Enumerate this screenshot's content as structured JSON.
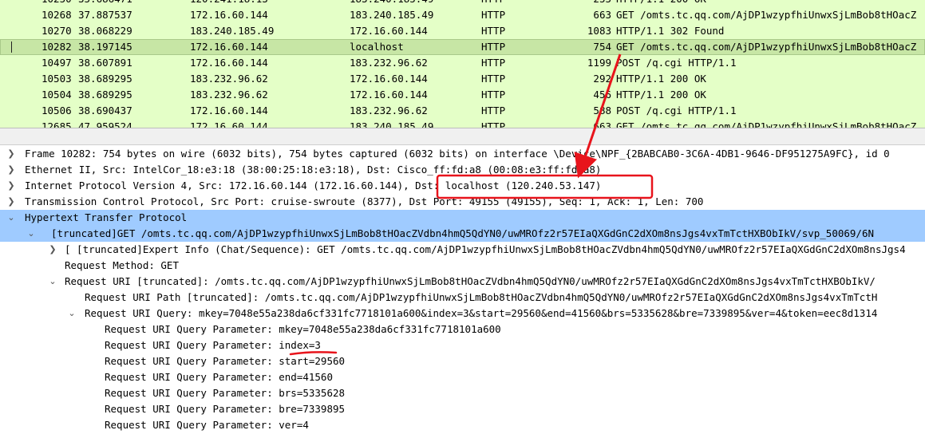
{
  "packet_list": {
    "rows": [
      {
        "no": "10250",
        "time": "35.686471",
        "src": "120.241.18.13",
        "dst": "183.240.185.49",
        "proto": "HTTP",
        "len": "255",
        "info": "HTTP/1.1 200 OK"
      },
      {
        "no": "10268",
        "time": "37.887537",
        "src": "172.16.60.144",
        "dst": "183.240.185.49",
        "proto": "HTTP",
        "len": "663",
        "info": "GET /omts.tc.qq.com/AjDP1wzypfhiUnwxSjLmBob8tHOacZ"
      },
      {
        "no": "10270",
        "time": "38.068229",
        "src": "183.240.185.49",
        "dst": "172.16.60.144",
        "proto": "HTTP",
        "len": "1083",
        "info": "HTTP/1.1 302 Found"
      },
      {
        "no": "10282",
        "time": "38.197145",
        "src": "172.16.60.144",
        "dst": "localhost",
        "proto": "HTTP",
        "len": "754",
        "info": "GET /omts.tc.qq.com/AjDP1wzypfhiUnwxSjLmBob8tHOacZ"
      },
      {
        "no": "10497",
        "time": "38.607891",
        "src": "172.16.60.144",
        "dst": "183.232.96.62",
        "proto": "HTTP",
        "len": "1199",
        "info": "POST /q.cgi HTTP/1.1"
      },
      {
        "no": "10503",
        "time": "38.689295",
        "src": "183.232.96.62",
        "dst": "172.16.60.144",
        "proto": "HTTP",
        "len": "292",
        "info": "HTTP/1.1 200 OK"
      },
      {
        "no": "10504",
        "time": "38.689295",
        "src": "183.232.96.62",
        "dst": "172.16.60.144",
        "proto": "HTTP",
        "len": "456",
        "info": "HTTP/1.1 200 OK"
      },
      {
        "no": "10506",
        "time": "38.690437",
        "src": "172.16.60.144",
        "dst": "183.232.96.62",
        "proto": "HTTP",
        "len": "588",
        "info": "POST /q.cgi HTTP/1.1"
      },
      {
        "no": "12685",
        "time": "47.959524",
        "src": "172.16.60.144",
        "dst": "183.240.185.49",
        "proto": "HTTP",
        "len": "663",
        "info": "GET /omts.tc.qq.com/AjDP1wzypfhiUnwxSjLmBob8tHOacZ"
      }
    ]
  },
  "details": {
    "frame": "Frame 10282: 754 bytes on wire (6032 bits), 754 bytes captured (6032 bits) on interface \\Device\\NPF_{2BABCAB0-3C6A-4DB1-9646-DF951275A9FC}, id 0",
    "ethernet": "Ethernet II, Src: IntelCor_18:e3:18 (38:00:25:18:e3:18), Dst: Cisco_ff:fd:a8 (00:08:e3:ff:fd:a8)",
    "ip": "Internet Protocol Version 4, Src: 172.16.60.144 (172.16.60.144), Dst: localhost (120.240.53.147)",
    "tcp": "Transmission Control Protocol, Src Port: cruise-swroute (8377), Dst Port: 49155 (49155), Seq: 1, Ack: 1, Len: 700",
    "http": "Hypertext Transfer Protocol",
    "http_get": "[truncated]GET /omts.tc.qq.com/AjDP1wzypfhiUnwxSjLmBob8tHOacZVdbn4hmQ5QdYN0/uwMROfz2r57EIaQXGdGnC2dXOm8nsJgs4vxTmTctHXBObIkV/svp_50069/6N",
    "expert": "[ [truncated]Expert Info (Chat/Sequence): GET /omts.tc.qq.com/AjDP1wzypfhiUnwxSjLmBob8tHOacZVdbn4hmQ5QdYN0/uwMROfz2r57EIaQXGdGnC2dXOm8nsJgs4",
    "method": "Request Method: GET",
    "uri": "Request URI [truncated]: /omts.tc.qq.com/AjDP1wzypfhiUnwxSjLmBob8tHOacZVdbn4hmQ5QdYN0/uwMROfz2r57EIaQXGdGnC2dXOm8nsJgs4vxTmTctHXBObIkV/",
    "uri_path": "Request URI Path [truncated]: /omts.tc.qq.com/AjDP1wzypfhiUnwxSjLmBob8tHOacZVdbn4hmQ5QdYN0/uwMROfz2r57EIaQXGdGnC2dXOm8nsJgs4vxTmTctH",
    "uri_query": "Request URI Query: mkey=7048e55a238da6cf331fc7718101a600&index=3&start=29560&end=41560&brs=5335628&bre=7339895&ver=4&token=eec8d1314",
    "params": [
      "Request URI Query Parameter: mkey=7048e55a238da6cf331fc7718101a600",
      "Request URI Query Parameter: index=3",
      "Request URI Query Parameter: start=29560",
      "Request URI Query Parameter: end=41560",
      "Request URI Query Parameter: brs=5335628",
      "Request URI Query Parameter: bre=7339895",
      "Request URI Query Parameter: ver=4"
    ]
  },
  "icons": {
    "collapsed": "chevron-right-icon",
    "expanded": "chevron-down-icon"
  },
  "colors": {
    "http_row": "#e4ffc7",
    "selected_row": "#c7e6a5",
    "highlight": "#9fcbff",
    "annotation": "#e8141c"
  }
}
